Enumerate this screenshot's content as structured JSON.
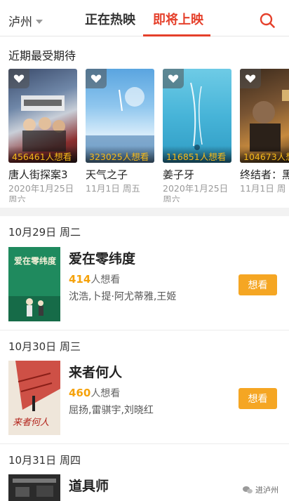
{
  "header": {
    "city": "泸州",
    "tab_now": "正在热映",
    "tab_soon": "即将上映"
  },
  "anticipated": {
    "title": "近期最受期待",
    "want_suffix": "人想看",
    "items": [
      {
        "count": "456461",
        "title": "唐人街探案3",
        "date_line1": "2020年1月25日",
        "date_line2": "周六"
      },
      {
        "count": "323025",
        "title": "天气之子",
        "date_line1": "11月1日 周五",
        "date_line2": ""
      },
      {
        "count": "116851",
        "title": "姜子牙",
        "date_line1": "2020年1月25日",
        "date_line2": "周六"
      },
      {
        "count": "104673",
        "title": "终结者：黑",
        "date_line1": "11月1日 周",
        "date_line2": ""
      }
    ]
  },
  "groups": [
    {
      "date": "10月29日 周二",
      "movie": {
        "title": "爱在零纬度",
        "want_count": "414",
        "want_suffix": "人想看",
        "cast": "沈浩,卜提·阿尤蒂雅,王姬",
        "button": "想看"
      }
    },
    {
      "date": "10月30日 周三",
      "movie": {
        "title": "来者何人",
        "want_count": "460",
        "want_suffix": "人想看",
        "cast": "屈扬,雷骐宇,刘晓红",
        "button": "想看"
      }
    },
    {
      "date": "10月31日 周四",
      "movie": {
        "title": "道具师"
      }
    }
  ],
  "watermark": "进泸州"
}
